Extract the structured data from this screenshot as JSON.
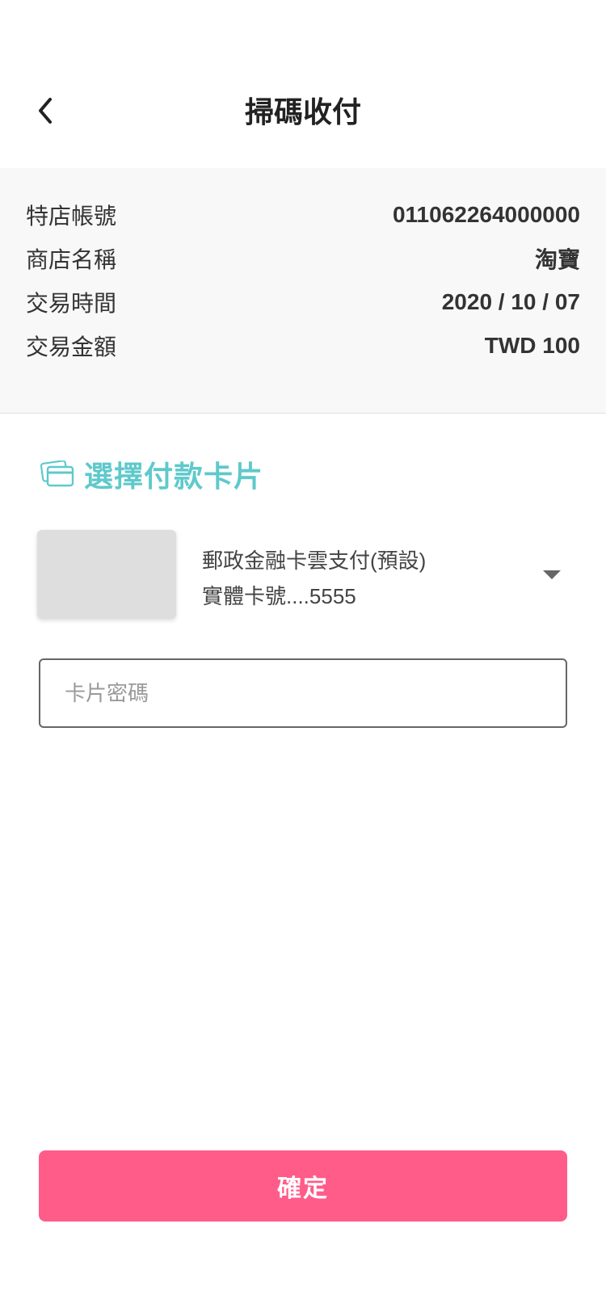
{
  "header": {
    "title": "掃碼收付",
    "back_icon": "chevron-left-icon"
  },
  "info": {
    "rows": [
      {
        "label": "特店帳號",
        "value": "011062264000000"
      },
      {
        "label": "商店名稱",
        "value": "淘寶"
      },
      {
        "label": "交易時間",
        "value": "2020 / 10 / 07"
      },
      {
        "label": "交易金額",
        "value": "TWD 100"
      }
    ]
  },
  "payment": {
    "section_title": "選擇付款卡片",
    "section_icon": "credit-card-icon",
    "card_name": "郵政金融卡雲支付(預設)",
    "card_number": "實體卡號....5555",
    "dropdown_icon": "caret-down-icon",
    "password_placeholder": "卡片密碼"
  },
  "confirm_label": "確定",
  "colors": {
    "accent": "#5fc9cb",
    "primary": "#ff5c8a",
    "info_bg": "#f8f8f8"
  }
}
